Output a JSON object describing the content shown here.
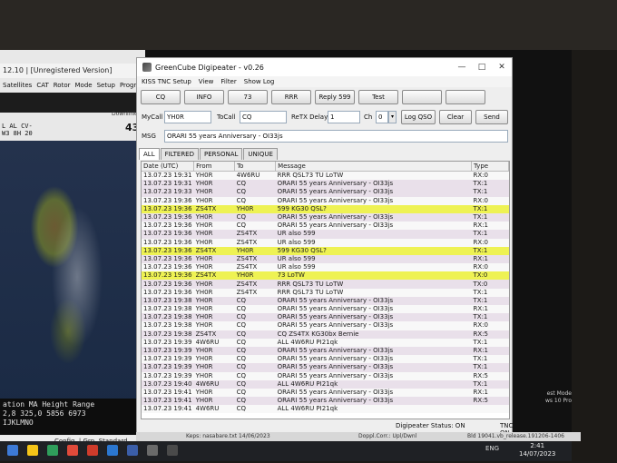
{
  "background_app": {
    "title": "12.10 | [Unregistered Version]",
    "menu": [
      "Satellites",
      "CAT",
      "Rotor",
      "Mode",
      "Setup",
      "Progr"
    ],
    "downlink_label": "Downlink",
    "big_number": "43",
    "lines": [
      "L AL CV-",
      "W3 8H 20"
    ],
    "status_header": "ation  MA  Height  Range",
    "status_values": "2,8  325,0  5856  6973",
    "status_letters": "IJKLMNO",
    "config_text": "Config. | Grp. Standard"
  },
  "window": {
    "title": "GreenCube Digipeater - v0.26",
    "controls": {
      "minimize": "—",
      "maximize": "□",
      "close": "✕"
    },
    "menu": [
      "KISS TNC Setup",
      "View",
      "Filter",
      "Show Log"
    ],
    "buttons": [
      "CQ",
      "INFO",
      "73",
      "RRR",
      "Reply 599",
      "Test",
      "",
      "",
      "",
      "",
      "",
      ""
    ],
    "mycall_label": "MyCall",
    "mycall_value": "YH0R",
    "tocall_label": "ToCall",
    "tocall_value": "CQ",
    "retx_label": "ReTX Delay",
    "retx_value": "1",
    "ch_label": "Ch",
    "ch_value": "0",
    "log_qso": "Log QSO",
    "clear": "Clear",
    "send": "Send",
    "msg_label": "MSG",
    "msg_value": "ORARI 55 years Anniversary - OI33js",
    "tabs": [
      "ALL",
      "FILTERED",
      "PERSONAL",
      "UNIQUE"
    ],
    "columns": [
      "Date (UTC)",
      "From",
      "To",
      "Message",
      "Type"
    ],
    "rows": [
      [
        "13.07.23 19:31",
        "YH0R",
        "4W6RU",
        "RRR QSL73 TU LoTW",
        "RX:0",
        "rx"
      ],
      [
        "13.07.23 19:31",
        "YH0R",
        "CQ",
        "ORARI 55 years Anniversary - OI33js",
        "TX:1",
        "tx"
      ],
      [
        "13.07.23 19:33",
        "YH0R",
        "CQ",
        "ORARI 55 years Anniversary - OI33js",
        "TX:1",
        "tx"
      ],
      [
        "13.07.23 19:36",
        "YH0R",
        "CQ",
        "ORARI 55 years Anniversary - OI33js",
        "RX:0",
        "rx"
      ],
      [
        "13.07.23 19:36",
        "ZS4TX",
        "YH0R",
        "599 KG30 QSL?",
        "TX:1",
        "hl"
      ],
      [
        "13.07.23 19:36",
        "YH0R",
        "CQ",
        "ORARI 55 years Anniversary - OI33js",
        "TX:1",
        "tx"
      ],
      [
        "13.07.23 19:36",
        "YH0R",
        "CQ",
        "ORARI 55 years Anniversary - OI33js",
        "RX:1",
        "rx"
      ],
      [
        "13.07.23 19:36",
        "YH0R",
        "ZS4TX",
        "UR also 599",
        "TX:1",
        "tx"
      ],
      [
        "13.07.23 19:36",
        "YH0R",
        "ZS4TX",
        "UR also 599",
        "RX:0",
        "rx"
      ],
      [
        "13.07.23 19:36",
        "ZS4TX",
        "YH0R",
        "599 KG30 QSL?",
        "TX:1",
        "hl"
      ],
      [
        "13.07.23 19:36",
        "YH0R",
        "ZS4TX",
        "UR also 599",
        "RX:1",
        "tx"
      ],
      [
        "13.07.23 19:36",
        "YH0R",
        "ZS4TX",
        "UR also 599",
        "RX:0",
        "rx"
      ],
      [
        "13.07.23 19:36",
        "ZS4TX",
        "YH0R",
        "73 LoTW",
        "TX:0",
        "hl"
      ],
      [
        "13.07.23 19:36",
        "YH0R",
        "ZS4TX",
        "RRR QSL73 TU LoTW",
        "TX:0",
        "tx"
      ],
      [
        "13.07.23 19:36",
        "YH0R",
        "ZS4TX",
        "RRR QSL73 TU LoTW",
        "TX:1",
        "rx"
      ],
      [
        "13.07.23 19:38",
        "YH0R",
        "CQ",
        "ORARI 55 years Anniversary - OI33js",
        "TX:1",
        "tx"
      ],
      [
        "13.07.23 19:38",
        "YH0R",
        "CQ",
        "ORARI 55 years Anniversary - OI33js",
        "RX:1",
        "rx"
      ],
      [
        "13.07.23 19:38",
        "YH0R",
        "CQ",
        "ORARI 55 years Anniversary - OI33js",
        "TX:1",
        "tx"
      ],
      [
        "13.07.23 19:38",
        "YH0R",
        "CQ",
        "ORARI 55 years Anniversary - OI33js",
        "RX:0",
        "rx"
      ],
      [
        "13.07.23 19:38",
        "ZS4TX",
        "CQ",
        "CQ ZS4TX KG30bx Bernie",
        "RX:5",
        "tx"
      ],
      [
        "13.07.23 19:39",
        "4W6RU",
        "CQ",
        "ALL  4W6RU PI21qk",
        "TX:1",
        "rx"
      ],
      [
        "13.07.23 19:39",
        "YH0R",
        "CQ",
        "ORARI 55 years Anniversary - OI33js",
        "RX:1",
        "tx"
      ],
      [
        "13.07.23 19:39",
        "YH0R",
        "CQ",
        "ORARI 55 years Anniversary - OI33js",
        "TX:1",
        "rx"
      ],
      [
        "13.07.23 19:39",
        "YH0R",
        "CQ",
        "ORARI 55 years Anniversary - OI33js",
        "TX:1",
        "tx"
      ],
      [
        "13.07.23 19:39",
        "YH0R",
        "CQ",
        "ORARI 55 years Anniversary - OI33js",
        "RX:5",
        "rx"
      ],
      [
        "13.07.23 19:40",
        "4W6RU",
        "CQ",
        "ALL  4W6RU PI21qk",
        "TX:1",
        "tx"
      ],
      [
        "13.07.23 19:41",
        "YH0R",
        "CQ",
        "ORARI 55 years Anniversary - OI33js",
        "RX:1",
        "rx"
      ],
      [
        "13.07.23 19:41",
        "YH0R",
        "CQ",
        "ORARI 55 years Anniversary - OI33js",
        "RX:5",
        "tx"
      ],
      [
        "13.07.23 19:41",
        "4W6RU",
        "CQ",
        "ALL  4W6RU PI21qk",
        "",
        "rx"
      ]
    ],
    "status_digi": "Digipeater Status:  ON",
    "status_tnc": "TNC: ON"
  },
  "bottom_bar": {
    "keps": "Keps: nasabare.txt 14/06/2023",
    "doppler": "Doppl.Corr.: Upl/Dwnl",
    "build": "Bld 19041.vb_release.191206-1406"
  },
  "desktop_right": [
    "est Mode",
    "ws 10 Pro"
  ],
  "taskbar": {
    "lang": "ENG",
    "time": "2:41",
    "date": "14/07/2023"
  },
  "colors": {
    "tx_row": "#e9e0ea",
    "highlight_row": "#eef253",
    "rx_row": "#f8f8f8"
  }
}
